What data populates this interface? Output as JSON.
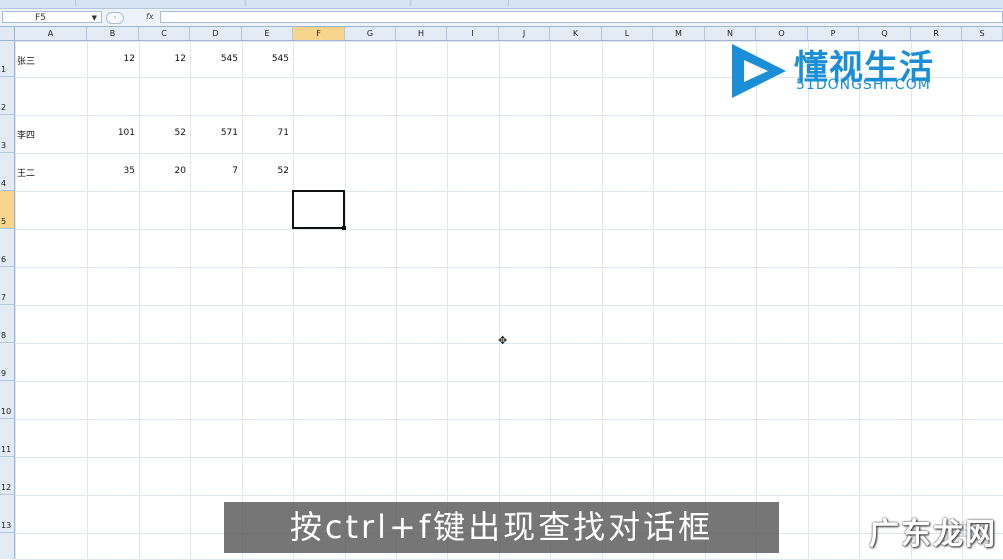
{
  "formula_bar": {
    "name_box": "F5",
    "fx_label": "fx",
    "formula": ""
  },
  "columns": [
    "A",
    "B",
    "C",
    "D",
    "E",
    "F",
    "G",
    "H",
    "I",
    "J",
    "K",
    "L",
    "M",
    "N",
    "O",
    "P",
    "Q",
    "R",
    "S"
  ],
  "selected_column": "F",
  "rows": [
    "1",
    "2",
    "3",
    "4",
    "5",
    "6",
    "7",
    "8",
    "9",
    "10",
    "11",
    "12",
    "13"
  ],
  "selected_row": "5",
  "cells": {
    "A1": "张三",
    "B1": "12",
    "C1": "12",
    "D1": "545",
    "E1": "545",
    "A3": "李四",
    "B3": "101",
    "C3": "52",
    "D3": "571",
    "E3": "71",
    "A4": "王二",
    "B4": "35",
    "C4": "20",
    "D4": "7",
    "E4": "52"
  },
  "logo": {
    "cn": "懂视生活",
    "en": "51DONGSHI.COM"
  },
  "subtitle": "按ctrl+f键出现查找对话框",
  "watermark": "广东龙网",
  "watermark_faint": "生活",
  "colors": {
    "accent": "#1a8fd8",
    "selected_header": "#f8d58c"
  }
}
